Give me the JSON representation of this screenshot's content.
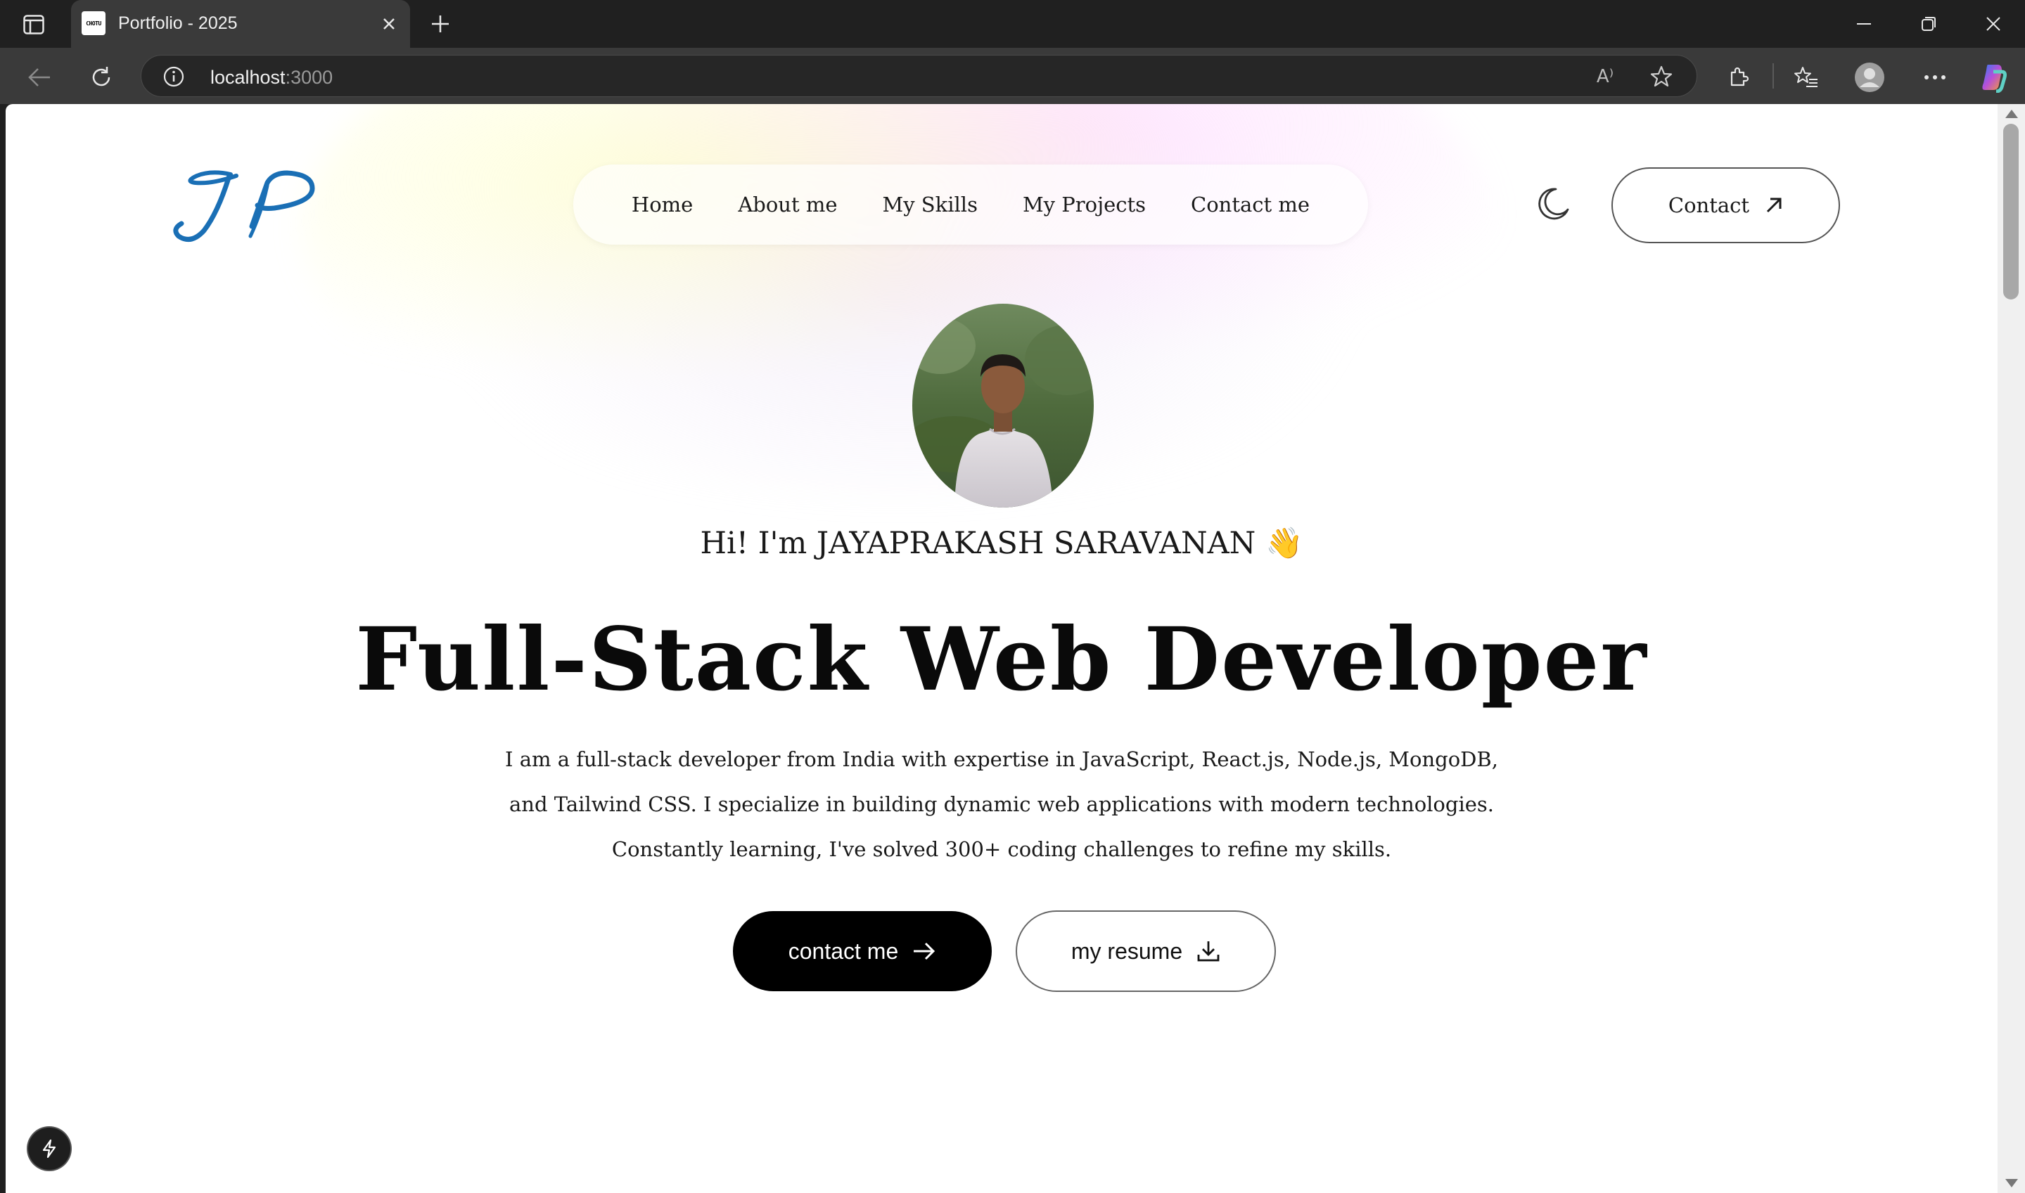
{
  "browser": {
    "tab_title": "Portfolio - 2025",
    "favicon_text": "CHOTU",
    "url_host": "localhost",
    "url_port": ":3000",
    "read_aloud_label": "A⁾"
  },
  "header": {
    "logo_text": "JP",
    "nav": [
      {
        "label": "Home"
      },
      {
        "label": "About me"
      },
      {
        "label": "My Skills"
      },
      {
        "label": "My Projects"
      },
      {
        "label": "Contact me"
      }
    ],
    "contact_label": "Contact"
  },
  "hero": {
    "greeting": "Hi! I'm JAYAPRAKASH SARAVANAN",
    "wave": "👋",
    "headline": "Full-Stack Web Developer",
    "desc_line1": "I am a full-stack developer from India with expertise in JavaScript, React.js, Node.js, MongoDB,",
    "desc_line2": "and Tailwind CSS. I specialize in building dynamic web applications with modern technologies.",
    "desc_line3": "Constantly learning, I've solved 300+ coding challenges to refine my skills.",
    "contact_button": "contact me",
    "resume_button": "my resume"
  },
  "colors": {
    "logo": "#1a6fb5",
    "chrome_dark": "#202020",
    "chrome_tab": "#3a3a3a",
    "button_dark": "#000000"
  },
  "icons": [
    "sidebar-toggle-icon",
    "close-icon",
    "plus-icon",
    "minimize-icon",
    "restore-icon",
    "back-icon",
    "reload-icon",
    "info-icon",
    "star-icon",
    "extensions-icon",
    "favorites-icon",
    "profile-icon",
    "more-icon",
    "copilot-icon",
    "moon-icon",
    "arrow-up-right-icon",
    "arrow-right-icon",
    "download-icon",
    "lightning-icon"
  ]
}
